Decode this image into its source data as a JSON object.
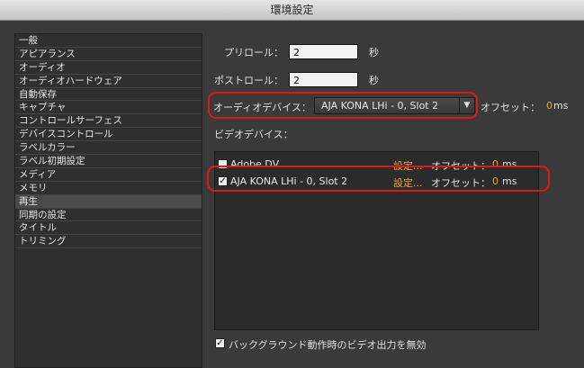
{
  "window": {
    "title": "環境設定"
  },
  "sidebar": {
    "items": [
      {
        "label": "一般"
      },
      {
        "label": "アピアランス"
      },
      {
        "label": "オーディオ"
      },
      {
        "label": "オーディオハードウェア"
      },
      {
        "label": "自動保存"
      },
      {
        "label": "キャプチャ"
      },
      {
        "label": "コントロールサーフェス"
      },
      {
        "label": "デバイスコントロール"
      },
      {
        "label": "ラベルカラー"
      },
      {
        "label": "ラベル初期設定"
      },
      {
        "label": "メディア"
      },
      {
        "label": "メモリ"
      },
      {
        "label": "再生",
        "selected": true
      },
      {
        "label": "同期の設定"
      },
      {
        "label": "タイトル"
      },
      {
        "label": "トリミング"
      }
    ]
  },
  "playback": {
    "preroll_label": "プリロール：",
    "preroll_value": "2",
    "preroll_unit": "秒",
    "postroll_label": "ポストロール：",
    "postroll_value": "2",
    "postroll_unit": "秒",
    "audio_device_label": "オーディオデバイス：",
    "audio_device_value": "AJA KONA LHi - 0, Slot 2",
    "audio_offset_label": "オフセット：",
    "audio_offset_value": "0",
    "audio_offset_unit": "ms",
    "video_device_label": "ビデオデバイス：",
    "video_devices": [
      {
        "name": "Adobe DV",
        "checked": false,
        "settings": "設定...",
        "offset_label": "オフセット：",
        "offset_value": "0",
        "unit": "ms"
      },
      {
        "name": "AJA KONA LHi - 0, Slot 2",
        "checked": true,
        "settings": "設定...",
        "offset_label": "オフセット：",
        "offset_value": "0",
        "unit": "ms"
      }
    ],
    "disable_bg_label": "バックグラウンド動作時のビデオ出力を無効",
    "disable_bg_checked": true
  },
  "colors": {
    "accent": "#e5a82a",
    "highlight_ring": "#e01818"
  }
}
